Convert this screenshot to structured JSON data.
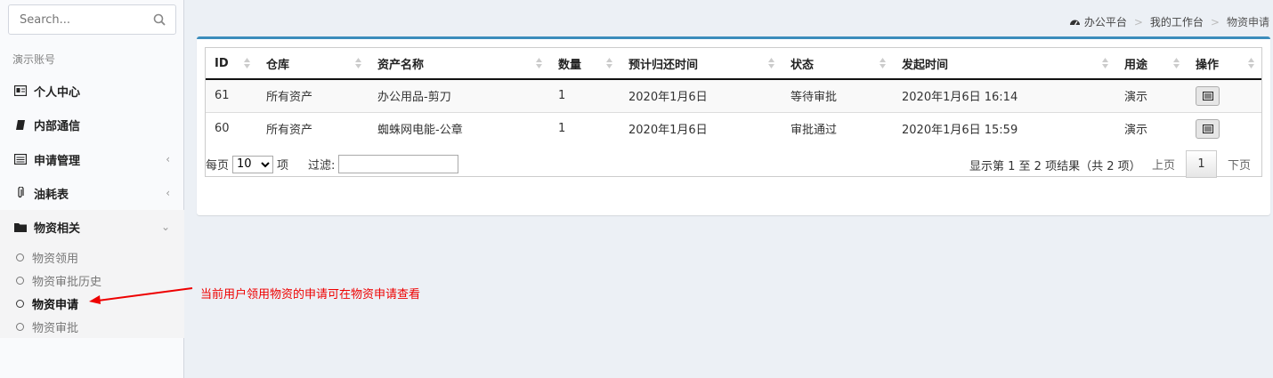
{
  "sidebar": {
    "search_placeholder": "Search...",
    "section_header": "演示账号",
    "items": [
      {
        "label": "个人中心",
        "icon": "id-card-icon"
      },
      {
        "label": "内部通信",
        "icon": "book-icon"
      },
      {
        "label": "申请管理",
        "icon": "list-alt-icon",
        "chevron": "‹"
      },
      {
        "label": "油耗表",
        "icon": "paperclip-icon",
        "chevron": "‹"
      },
      {
        "label": "物资相关",
        "icon": "folder-icon",
        "chevron": "⌄"
      }
    ],
    "subitems": [
      {
        "label": "物资领用"
      },
      {
        "label": "物资审批历史"
      },
      {
        "label": "物资申请"
      },
      {
        "label": "物资审批"
      }
    ]
  },
  "breadcrumb": {
    "home": "办公平台",
    "sep": ">",
    "level2": "我的工作台",
    "current": "物资申请"
  },
  "table": {
    "headers": [
      "ID",
      "仓库",
      "资产名称",
      "数量",
      "预计归还时间",
      "状态",
      "发起时间",
      "用途",
      "操作"
    ],
    "rows": [
      [
        "61",
        "所有资产",
        "办公用品-剪刀",
        "1",
        "2020年1月6日",
        "等待审批",
        "2020年1月6日 16:14",
        "演示"
      ],
      [
        "60",
        "所有资产",
        "蜘蛛网电能-公章",
        "1",
        "2020年1月6日",
        "审批通过",
        "2020年1月6日 15:59",
        "演示"
      ]
    ]
  },
  "footer": {
    "per_page_prefix": "每页",
    "per_page_value": "10",
    "per_page_suffix": "项",
    "filter_label": "过滤:",
    "info": "显示第 1 至 2 项结果（共 2 项）",
    "prev": "上页",
    "page": "1",
    "next": "下页"
  },
  "annotation": "当前用户领用物资的申请可在物资申请查看",
  "colors": {
    "accent": "#3c8dbc",
    "annotation": "#e00000"
  }
}
